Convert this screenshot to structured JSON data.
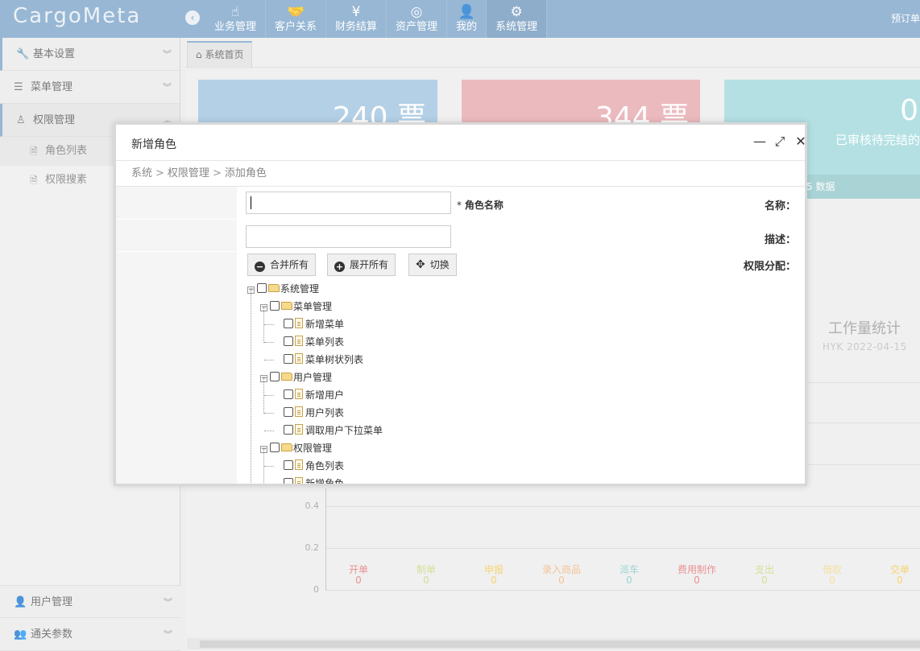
{
  "app": {
    "brand": "CargoMeta",
    "top_right_text": "预订单"
  },
  "nav": [
    {
      "icon": "hand-pointer-icon",
      "glyph": "☝",
      "label": "业务管理"
    },
    {
      "icon": "handshake-icon",
      "glyph": "🤝",
      "label": "客户关系"
    },
    {
      "icon": "yen-icon",
      "glyph": "¥",
      "label": "财务结算"
    },
    {
      "icon": "basketball-icon",
      "glyph": "◎",
      "label": "资产管理"
    },
    {
      "icon": "user-icon",
      "glyph": "👤",
      "label": "我的"
    },
    {
      "icon": "gear-icon",
      "glyph": "⚙",
      "label": "系统管理"
    }
  ],
  "sidebar": {
    "sections": [
      {
        "icon": "wrench-icon",
        "glyph": "🔧",
        "label": "基本设置"
      },
      {
        "icon": "list-icon",
        "glyph": "☰",
        "label": "菜单管理"
      },
      {
        "icon": "user-lock-icon",
        "glyph": "♙",
        "label": "权限管理"
      }
    ],
    "sub_items": [
      {
        "icon": "file-icon",
        "glyph": "🗎",
        "label": "角色列表"
      },
      {
        "icon": "file-icon",
        "glyph": "🗎",
        "label": "权限搜素"
      }
    ],
    "bottom": [
      {
        "icon": "user-icon",
        "glyph": "👤",
        "label": "用户管理"
      },
      {
        "icon": "users-icon",
        "glyph": "👥",
        "label": "通关参数"
      }
    ]
  },
  "tabs": {
    "home_label": "系统首页",
    "home_glyph": "⌂"
  },
  "cards": [
    {
      "value": "240 票",
      "color": "#9fc3df"
    },
    {
      "value": "344 票",
      "color": "#e6a7ad"
    },
    {
      "value": "0",
      "subtitle": "已审核待完结的",
      "footer": "5 数据",
      "color": "#9fd8dc"
    }
  ],
  "chart_data": {
    "type": "bar",
    "title": "工作量统计",
    "subtitle": "HYK 2022-04-15",
    "y_ticks": [
      "0.4",
      "0.2",
      "0"
    ],
    "categories": [
      "开单",
      "制单",
      "申报",
      "录入商品",
      "派车",
      "费用制作",
      "支出",
      "借款",
      "交单"
    ],
    "values": [
      0,
      0,
      0,
      0,
      0,
      0,
      0,
      0,
      0
    ],
    "label_colors": [
      "#e57373",
      "#c5d97a",
      "#f2c94c",
      "#f0b27a",
      "#7ec8c9",
      "#e57373",
      "#c5d97a",
      "#f2d78a",
      "#f2c94c"
    ]
  },
  "modal": {
    "title": "新增角色",
    "breadcrumb": [
      "系统",
      "权限管理",
      "添加角色"
    ],
    "fields": {
      "name_label": "名称：",
      "name_value": "",
      "name_hint": "角色名称",
      "desc_label": "描述：",
      "desc_value": "",
      "perm_label": "权限分配："
    },
    "buttons": {
      "collapse_all": "合并所有",
      "expand_all": "展开所有",
      "toggle": "切换"
    },
    "tree": [
      {
        "label": "系统管理",
        "level": 0,
        "type": "folder"
      },
      {
        "label": "菜单管理",
        "level": 1,
        "type": "folder"
      },
      {
        "label": "新增菜单",
        "level": 2,
        "type": "page"
      },
      {
        "label": "菜单列表",
        "level": 2,
        "type": "page"
      },
      {
        "label": "菜单树状列表",
        "level": 2,
        "type": "page"
      },
      {
        "label": "用户管理",
        "level": 1,
        "type": "folder"
      },
      {
        "label": "新增用户",
        "level": 2,
        "type": "page"
      },
      {
        "label": "用户列表",
        "level": 2,
        "type": "page"
      },
      {
        "label": "调取用户下拉菜单",
        "level": 2,
        "type": "page"
      },
      {
        "label": "权限管理",
        "level": 1,
        "type": "folder"
      },
      {
        "label": "角色列表",
        "level": 2,
        "type": "page"
      },
      {
        "label": "新增角色",
        "level": 2,
        "type": "page"
      }
    ]
  }
}
